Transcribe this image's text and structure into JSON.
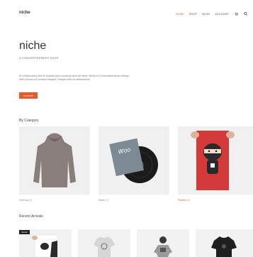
{
  "site": {
    "logo": "niche"
  },
  "nav": {
    "items": [
      {
        "label": "Home",
        "active": true
      },
      {
        "label": "Shop",
        "active": false
      },
      {
        "label": "Blog",
        "active": false
      },
      {
        "label": "Account",
        "active": false
      }
    ],
    "icons": [
      "cart-icon",
      "search-icon"
    ]
  },
  "hero": {
    "title": "niche",
    "subtitle": "A CONVERTEPRESS SHOP",
    "description": "An introductory text to explain your products and services. Niche is a minimalist shop design with a focus on product images. Simple with no distractions.",
    "button": "Go Shop"
  },
  "categories": {
    "title": "By Category",
    "items": [
      {
        "name": "Clothing",
        "count": "(5)"
      },
      {
        "name": "Music",
        "count": "(3)"
      },
      {
        "name": "Posters",
        "count": "(5)"
      }
    ]
  },
  "arrivals": {
    "title": "Recent Arrivals",
    "sale_badge": "Sale!",
    "vinyl_text": "Woo"
  },
  "colors": {
    "accent": "#e25d2b",
    "text": "#333333"
  }
}
